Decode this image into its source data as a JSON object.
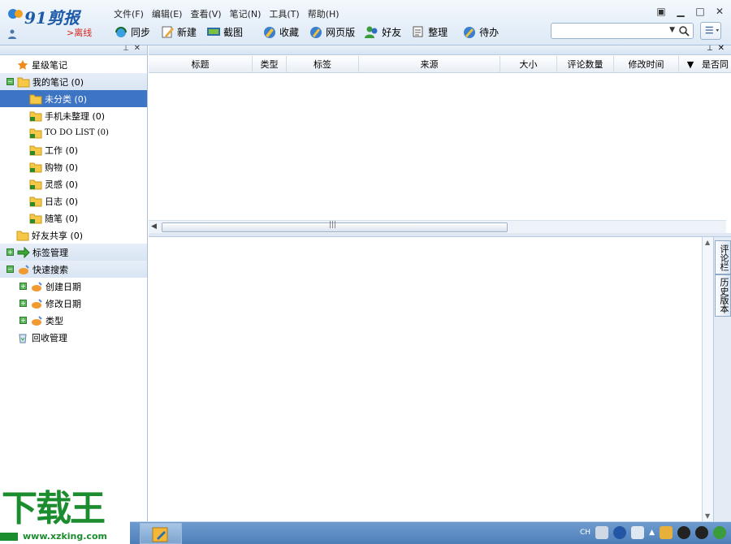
{
  "app": {
    "brand": "91剪报",
    "status": "离线"
  },
  "menu": [
    "文件(F)",
    "编辑(E)",
    "查看(V)",
    "笔记(N)",
    "工具(T)",
    "帮助(H)"
  ],
  "toolbar": [
    {
      "label": "同步",
      "icon": "sync-icon"
    },
    {
      "label": "新建",
      "icon": "new-note-icon"
    },
    {
      "label": "截图",
      "icon": "screenshot-icon"
    },
    {
      "label": "收藏",
      "icon": "favorite-icon"
    },
    {
      "label": "网页版",
      "icon": "web-icon"
    },
    {
      "label": "好友",
      "icon": "friends-icon"
    },
    {
      "label": "整理",
      "icon": "organize-icon"
    },
    {
      "label": "待办",
      "icon": "todo-icon"
    }
  ],
  "search": {
    "placeholder": ""
  },
  "tree": [
    {
      "label": "星级笔记",
      "icon": "star-icon"
    },
    {
      "label": "我的笔记 (0)",
      "icon": "folder-icon"
    },
    {
      "label": "未分类 (0)",
      "icon": "folder-icon"
    },
    {
      "label": "手机未整理 (0)",
      "icon": "folder-sync-icon"
    },
    {
      "label": "TO DO LIST (0)",
      "icon": "folder-sync-icon"
    },
    {
      "label": "工作 (0)",
      "icon": "folder-sync-icon"
    },
    {
      "label": "购物 (0)",
      "icon": "folder-sync-icon"
    },
    {
      "label": "灵感 (0)",
      "icon": "folder-sync-icon"
    },
    {
      "label": "日志 (0)",
      "icon": "folder-sync-icon"
    },
    {
      "label": "随笔 (0)",
      "icon": "folder-sync-icon"
    },
    {
      "label": "好友共享 (0)",
      "icon": "folder-icon"
    },
    {
      "label": "标签管理",
      "icon": "arrow-right-icon"
    },
    {
      "label": "快速搜索",
      "icon": "quick-search-icon"
    },
    {
      "label": "创建日期",
      "icon": "quick-search-icon"
    },
    {
      "label": "修改日期",
      "icon": "quick-search-icon"
    },
    {
      "label": "类型",
      "icon": "quick-search-icon"
    },
    {
      "label": "回收管理",
      "icon": "recycle-bin-icon"
    }
  ],
  "columns": [
    "标题",
    "类型",
    "标签",
    "来源",
    "大小",
    "评论数量",
    "修改时间",
    "是否同"
  ],
  "side_tabs": [
    "评论栏",
    "历史版本"
  ],
  "watermark": {
    "big": "下载王",
    "url": "www.xzking.com"
  },
  "tray": {
    "lang": "CH"
  },
  "colors": {
    "selection": "#3d74c4",
    "brand": "#1d5aa8",
    "offline": "#d9261c",
    "watermark": "#1c8d2f"
  }
}
